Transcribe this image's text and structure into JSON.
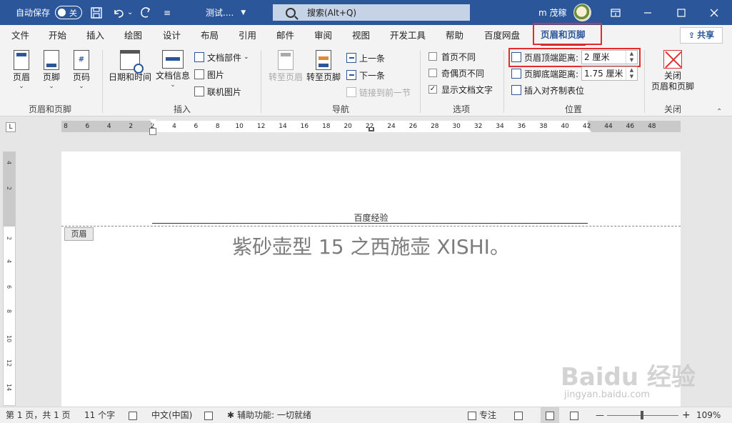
{
  "titlebar": {
    "autosave_label": "自动保存",
    "autosave_state": "关",
    "doc_title": "测试....",
    "search_placeholder": "搜索(Alt+Q)",
    "user_name": "m 茂稼"
  },
  "tabs": [
    "文件",
    "开始",
    "插入",
    "绘图",
    "设计",
    "布局",
    "引用",
    "邮件",
    "审阅",
    "视图",
    "开发工具",
    "帮助",
    "百度网盘",
    "页眉和页脚"
  ],
  "active_tab": "页眉和页脚",
  "share_label": "共享",
  "ribbon": {
    "hf_group": {
      "label": "页眉和页脚",
      "header": "页眉",
      "footer": "页脚",
      "page_number": "页码",
      "chev": "⌄"
    },
    "insert_group": {
      "label": "插入",
      "datetime": "日期和时间",
      "docinfo": "文档信息",
      "docparts": "文档部件",
      "docparts_chev": "⌄",
      "picture": "图片",
      "online_picture": "联机图片"
    },
    "nav_group": {
      "label": "导航",
      "goto_header": "转至页眉",
      "goto_footer": "转至页脚",
      "prev": "上一条",
      "next": "下一条",
      "link_prev": "链接到前一节"
    },
    "options_group": {
      "label": "选项",
      "first_page_diff": "首页不同",
      "odd_even_diff": "奇偶页不同",
      "show_doc_text": "显示文档文字",
      "check_mark": "✓"
    },
    "position_group": {
      "label": "位置",
      "header_top_label": "页眉顶端距离:",
      "header_top_value": "2 厘米",
      "footer_bottom_label": "页脚底端距离:",
      "footer_bottom_value": "1.75 厘米",
      "insert_align_tab": "插入对齐制表位",
      "spin_up": "▲",
      "spin_down": "▼"
    },
    "close_group": {
      "label": "关闭",
      "close_btn_line1": "关闭",
      "close_btn_line2": "页眉和页脚"
    }
  },
  "ruler_numbers": [
    "8",
    "6",
    "4",
    "2",
    "2",
    "4",
    "6",
    "8",
    "10",
    "12",
    "14",
    "16",
    "18",
    "20",
    "22",
    "24",
    "26",
    "28",
    "30",
    "32",
    "34",
    "36",
    "38",
    "40",
    "42",
    "44",
    "46",
    "48"
  ],
  "vruler_numbers": [
    "4",
    "2",
    "2",
    "4",
    "6",
    "8",
    "10",
    "12",
    "14",
    "16"
  ],
  "page": {
    "header_text": "百度经验",
    "header_tag": "页眉",
    "body_text": "紫砂壶型 15 之西施壶 XISHI。"
  },
  "watermark": {
    "main": "Baidu 经验",
    "sub": "jingyan.baidu.com"
  },
  "statusbar": {
    "page_info": "第 1 页，共 1 页",
    "word_count": "11 个字",
    "language": "中文(中国)",
    "accessibility": "辅助功能: 一切就绪",
    "focus": "专注",
    "zoom_minus": "—",
    "zoom_plus": "+",
    "zoom": "109%"
  },
  "colors": {
    "brand": "#2b579a",
    "highlight": "#e52b2b"
  }
}
